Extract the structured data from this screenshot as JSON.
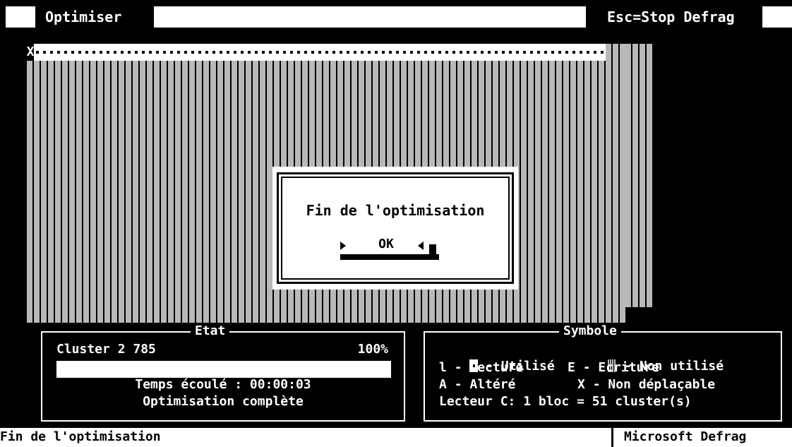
{
  "menubar": {
    "title": "Optimiser",
    "hint": "Esc=Stop Defrag"
  },
  "diskmap": {
    "unmovable_marker": "X",
    "used_cells": 81
  },
  "dialog": {
    "message": "Fin de l'optimisation",
    "ok_label": "OK"
  },
  "etat": {
    "title": "Etat",
    "cluster": "Cluster 2 785",
    "percent_label": "100%",
    "progress": 1.0,
    "elapsed": "Temps écoulé : 00:00:03",
    "status": "Optimisation complète"
  },
  "symbole": {
    "title": "Symbole",
    "utilise": "- Utilisé",
    "non_utilise": "- Non utilisé",
    "lecture_sym": "l",
    "lecture": "- Lecture",
    "ecriture_sym": "E",
    "ecriture": "- Ecriture",
    "altere_sym": "A",
    "altere": "- Altéré",
    "non_deplacable_sym": "X",
    "non_deplacable": "- Non déplaçable",
    "lecteur": "Lecteur C: 1 bloc = 51 cluster(s)"
  },
  "statusbar": {
    "left": "Fin de l'optimisation",
    "right": "Microsoft Defrag"
  }
}
